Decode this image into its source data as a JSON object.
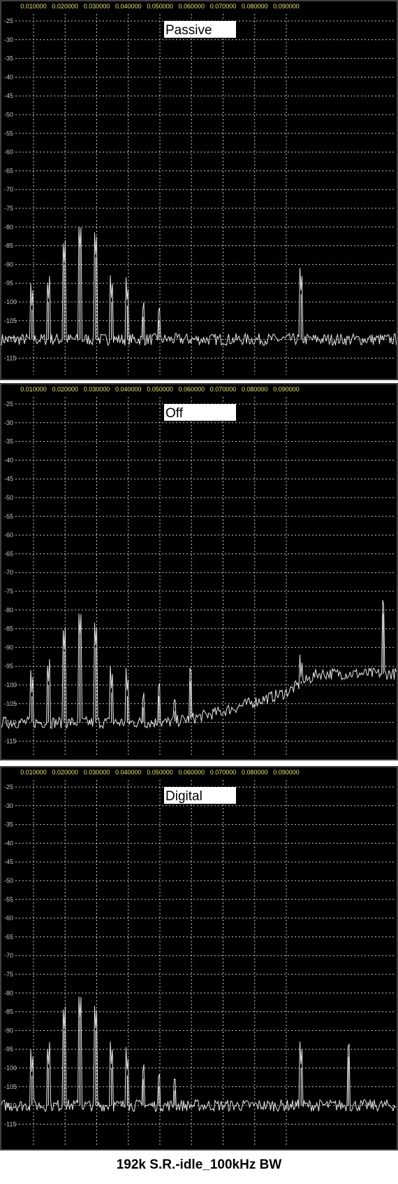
{
  "caption": "192k S.R.-idle_100kHz BW",
  "colors": {
    "background": "#000000",
    "grid": "#c8c8c8",
    "x_tick_text": "#e8e070",
    "y_tick_text": "#c8c8c8",
    "trace": "#e6e6e6",
    "label_box": "#ffffff",
    "label_text": "#000000"
  },
  "chart_data": [
    {
      "type": "line",
      "title": "Passive",
      "xlabel": "",
      "ylabel": "",
      "xlim": [
        0.0,
        0.1
      ],
      "ylim": [
        -118,
        -22
      ],
      "x_ticks": [
        "0.010000",
        "0.020000",
        "0.030000",
        "0.040000",
        "0.050000",
        "0.060000",
        "0.070000",
        "0.080000",
        "0.090000"
      ],
      "y_ticks": [
        "-25",
        "-30",
        "-35",
        "-40",
        "-45",
        "-50",
        "-55",
        "-60",
        "-65",
        "-70",
        "-75",
        "-80",
        "-85",
        "-90",
        "-95",
        "-100",
        "-105",
        "-110",
        "-115"
      ],
      "grid": true,
      "noise_floor": [
        [
          0.0,
          -110
        ],
        [
          0.1,
          -110
        ]
      ],
      "peaks": [
        {
          "x": 0.0095,
          "y": -102
        },
        {
          "x": 0.0147,
          "y": -100
        },
        {
          "x": 0.0197,
          "y": -90
        },
        {
          "x": 0.0247,
          "y": -86
        },
        {
          "x": 0.0297,
          "y": -88
        },
        {
          "x": 0.0347,
          "y": -100
        },
        {
          "x": 0.0397,
          "y": -101
        },
        {
          "x": 0.0447,
          "y": -104
        },
        {
          "x": 0.0497,
          "y": -105
        },
        {
          "x": 0.0947,
          "y": -98
        }
      ]
    },
    {
      "type": "line",
      "title": "Off",
      "xlabel": "",
      "ylabel": "",
      "xlim": [
        0.0,
        0.1
      ],
      "ylim": [
        -118,
        -22
      ],
      "x_ticks": [
        "0.010000",
        "0.020000",
        "0.030000",
        "0.040000",
        "0.050000",
        "0.060000",
        "0.070000",
        "0.080000",
        "0.090000"
      ],
      "y_ticks": [
        "-25",
        "-30",
        "-35",
        "-40",
        "-45",
        "-50",
        "-55",
        "-60",
        "-65",
        "-70",
        "-75",
        "-80",
        "-85",
        "-90",
        "-95",
        "-100",
        "-105",
        "-110",
        "-115"
      ],
      "grid": true,
      "noise_floor": [
        [
          0.0,
          -110
        ],
        [
          0.052,
          -110
        ],
        [
          0.06,
          -109
        ],
        [
          0.07,
          -107
        ],
        [
          0.08,
          -104.5
        ],
        [
          0.09,
          -102
        ],
        [
          0.1,
          -97
        ]
      ],
      "peaks": [
        {
          "x": 0.0095,
          "y": -103
        },
        {
          "x": 0.0147,
          "y": -100
        },
        {
          "x": 0.0197,
          "y": -91
        },
        {
          "x": 0.0247,
          "y": -87
        },
        {
          "x": 0.0297,
          "y": -90
        },
        {
          "x": 0.0347,
          "y": -102
        },
        {
          "x": 0.0397,
          "y": -103
        },
        {
          "x": 0.0447,
          "y": -106
        },
        {
          "x": 0.0497,
          "y": -103
        },
        {
          "x": 0.0547,
          "y": -107
        },
        {
          "x": 0.0597,
          "y": -99
        },
        {
          "x": 0.0947,
          "y": -99
        },
        {
          "x": 0.1207,
          "y": -81
        }
      ]
    },
    {
      "type": "line",
      "title": "Digital",
      "xlabel": "",
      "ylabel": "",
      "xlim": [
        0.0,
        0.1
      ],
      "ylim": [
        -118,
        -22
      ],
      "x_ticks": [
        "0.010000",
        "0.020000",
        "0.030000",
        "0.040000",
        "0.050000",
        "0.060000",
        "0.070000",
        "0.080000",
        "0.090000"
      ],
      "y_ticks": [
        "-25",
        "-30",
        "-35",
        "-40",
        "-45",
        "-50",
        "-55",
        "-60",
        "-65",
        "-70",
        "-75",
        "-80",
        "-85",
        "-90",
        "-95",
        "-100",
        "-105",
        "-110",
        "-115"
      ],
      "grid": true,
      "noise_floor": [
        [
          0.0,
          -110
        ],
        [
          0.1,
          -110
        ]
      ],
      "peaks": [
        {
          "x": 0.0095,
          "y": -102
        },
        {
          "x": 0.0147,
          "y": -100
        },
        {
          "x": 0.0197,
          "y": -90
        },
        {
          "x": 0.0247,
          "y": -87
        },
        {
          "x": 0.0297,
          "y": -90
        },
        {
          "x": 0.0347,
          "y": -100
        },
        {
          "x": 0.0397,
          "y": -102
        },
        {
          "x": 0.0447,
          "y": -103
        },
        {
          "x": 0.0497,
          "y": -105
        },
        {
          "x": 0.0547,
          "y": -106
        },
        {
          "x": 0.0947,
          "y": -100
        },
        {
          "x": 0.1097,
          "y": -97
        }
      ]
    }
  ]
}
